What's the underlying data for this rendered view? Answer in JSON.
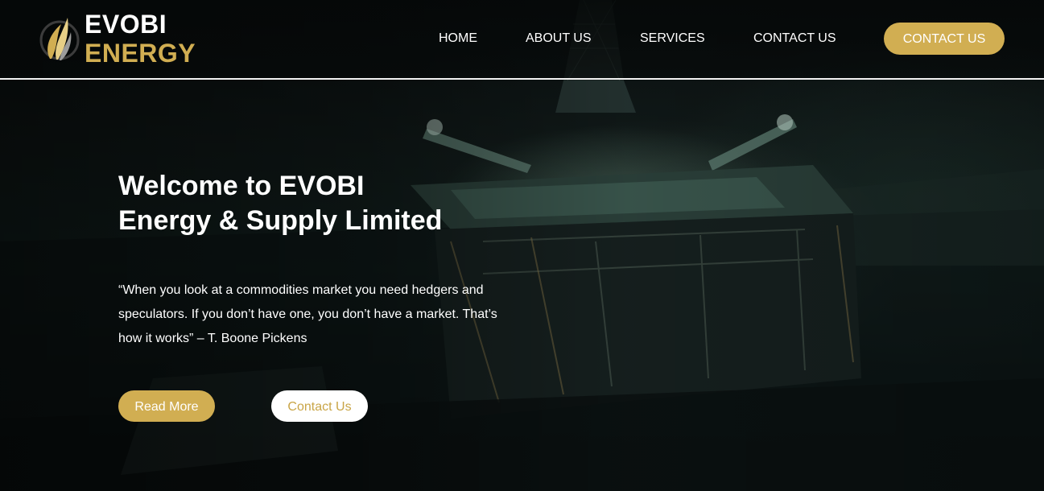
{
  "brand": {
    "name_line1": "EVOBI",
    "name_line2": "ENERGY",
    "logo_icon": "flame-swoosh-icon"
  },
  "nav": {
    "items": [
      {
        "label": "HOME"
      },
      {
        "label": "ABOUT US"
      },
      {
        "label": "SERVICES"
      },
      {
        "label": "CONTACT US"
      }
    ],
    "cta_label": "CONTACT US"
  },
  "hero": {
    "title_line1": "Welcome to EVOBI",
    "title_line2": "Energy & Supply Limited",
    "quote": "“When you look at a commodities market you need hedgers and speculators. If you don’t have one, you don’t have a market. That’s how it works” – T. Boone Pickens",
    "primary_button": "Read More",
    "secondary_button": "Contact Us",
    "background": "offshore-oil-rig-at-night"
  },
  "colors": {
    "accent_gold": "#d1ae52",
    "text_white": "#ffffff",
    "header_divider": "#f2f2f2"
  }
}
